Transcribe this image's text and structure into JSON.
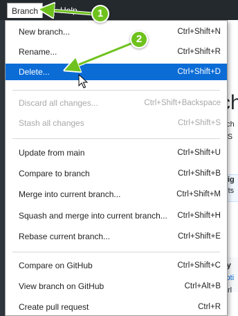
{
  "menubar": {
    "branch_label": "Branch",
    "help_label": "Help"
  },
  "background": {
    "heading_fragment": "ch",
    "line1": "d ch",
    "line2": "y. S",
    "line3": "orig",
    "line4": "mits",
    "line5": "n y",
    "line6": "Opti",
    "line7": "Ctrl"
  },
  "menu": {
    "items": [
      {
        "label": "New branch...",
        "accel": "Ctrl+Shift+N",
        "state": "normal"
      },
      {
        "label": "Rename...",
        "accel": "Ctrl+Shift+R",
        "state": "normal"
      },
      {
        "label": "Delete...",
        "accel": "Ctrl+Shift+D",
        "state": "selected"
      },
      {
        "label": "Discard all changes...",
        "accel": "Ctrl+Shift+Backspace",
        "state": "disabled"
      },
      {
        "label": "Stash all changes",
        "accel": "Ctrl+Shift+S",
        "state": "disabled"
      },
      {
        "label": "Update from main",
        "accel": "Ctrl+Shift+U",
        "state": "normal"
      },
      {
        "label": "Compare to branch",
        "accel": "Ctrl+Shift+B",
        "state": "normal"
      },
      {
        "label": "Merge into current branch...",
        "accel": "Ctrl+Shift+M",
        "state": "normal"
      },
      {
        "label": "Squash and merge into current branch...",
        "accel": "Ctrl+Shift+H",
        "state": "normal"
      },
      {
        "label": "Rebase current branch...",
        "accel": "Ctrl+Shift+E",
        "state": "normal"
      },
      {
        "label": "Compare on GitHub",
        "accel": "Ctrl+Shift+C",
        "state": "normal"
      },
      {
        "label": "View branch on GitHub",
        "accel": "Ctrl+Alt+B",
        "state": "normal"
      },
      {
        "label": "Create pull request",
        "accel": "Ctrl+R",
        "state": "normal"
      }
    ]
  },
  "annotations": {
    "callout1": "1",
    "callout2": "2",
    "accent_color": "#6fc21d",
    "selection_color": "#0b6cd6"
  }
}
